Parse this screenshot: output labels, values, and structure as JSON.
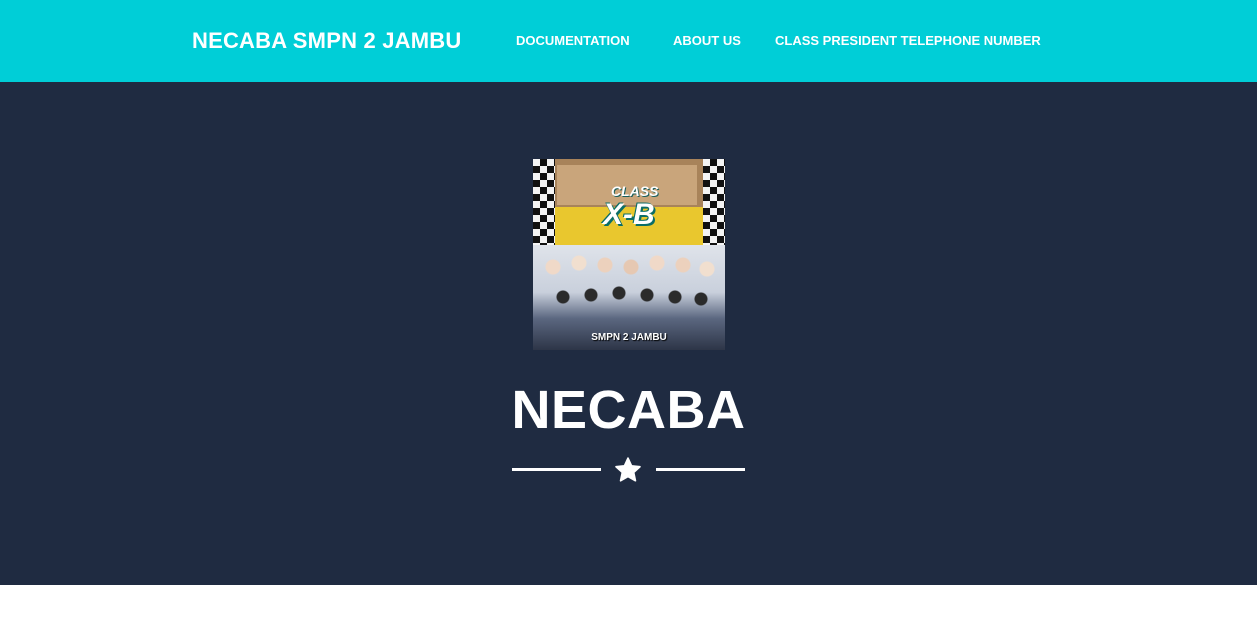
{
  "navbar": {
    "brand": "NECABA SMPN 2 JAMBU",
    "links": [
      {
        "label": "DOCUMENTATION"
      },
      {
        "label": "ABOUT US"
      },
      {
        "label": "CLASS PRESIDENT TELEPHONE NUMBER"
      }
    ]
  },
  "masthead": {
    "avatar": {
      "photo_text_class": "CLASS",
      "photo_text_xb": "X-B",
      "photo_caption": "SMPN 2 JAMBU"
    },
    "title": "NECABA",
    "divider_icon": "star-icon"
  },
  "colors": {
    "navbar_bg": "#00ced7",
    "masthead_bg": "#1f2b41",
    "text": "#ffffff"
  }
}
